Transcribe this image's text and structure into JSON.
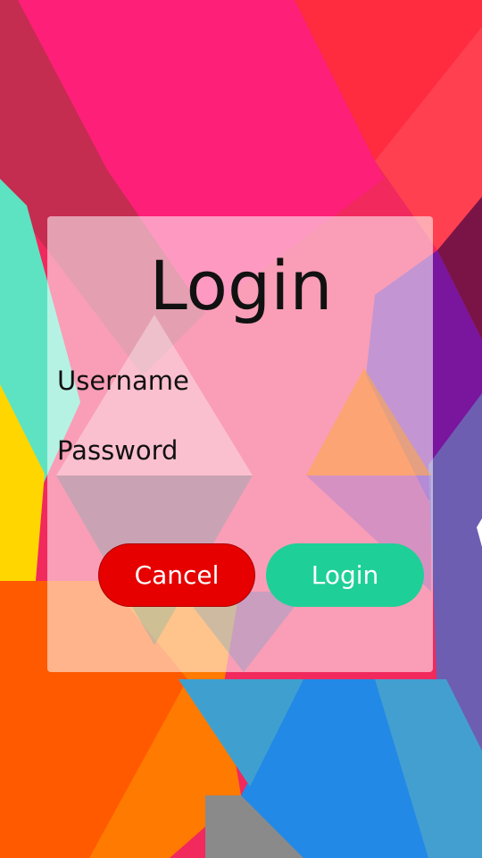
{
  "login_form": {
    "title": "Login",
    "username_label": "Username",
    "password_label": "Password",
    "cancel_label": "Cancel",
    "login_label": "Login"
  },
  "colors": {
    "cancel_button": "#e60000",
    "login_button": "#1fcf98",
    "panel_overlay": "rgba(255,255,255,0.55)"
  }
}
